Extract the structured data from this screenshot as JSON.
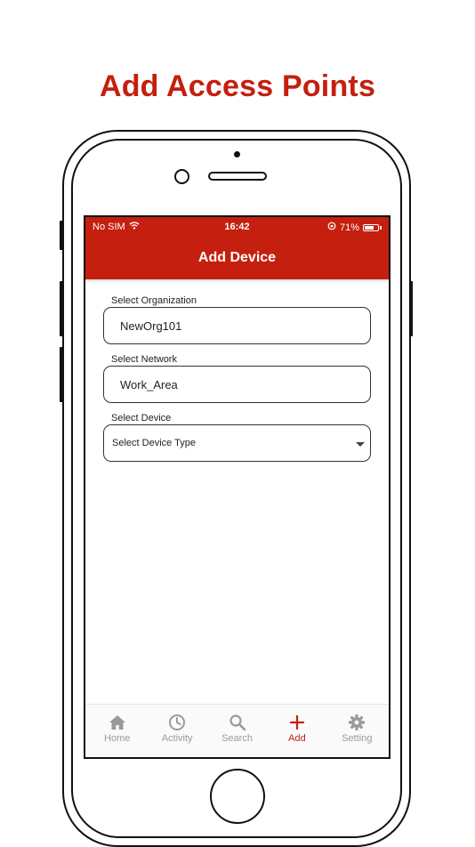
{
  "promo": {
    "title": "Add Access Points"
  },
  "status_bar": {
    "carrier": "No SIM",
    "time": "16:42",
    "battery": "71%",
    "battery_level": 0.71
  },
  "header": {
    "title": "Add Device"
  },
  "form": {
    "organization": {
      "label": "Select Organization",
      "value": "NewOrg101"
    },
    "network": {
      "label": "Select Network",
      "value": "Work_Area"
    },
    "device": {
      "label": "Select Device",
      "value": "Select Device Type"
    }
  },
  "tabbar": {
    "tabs": [
      {
        "label": "Home",
        "icon": "home-icon"
      },
      {
        "label": "Activity",
        "icon": "clock-icon"
      },
      {
        "label": "Search",
        "icon": "search-icon"
      },
      {
        "label": "Add",
        "icon": "plus-icon"
      },
      {
        "label": "Setting",
        "icon": "gear-icon"
      }
    ],
    "active_index": 3
  },
  "colors": {
    "brand": "#c41f0f",
    "inactive_tab": "#9a9a9a"
  }
}
